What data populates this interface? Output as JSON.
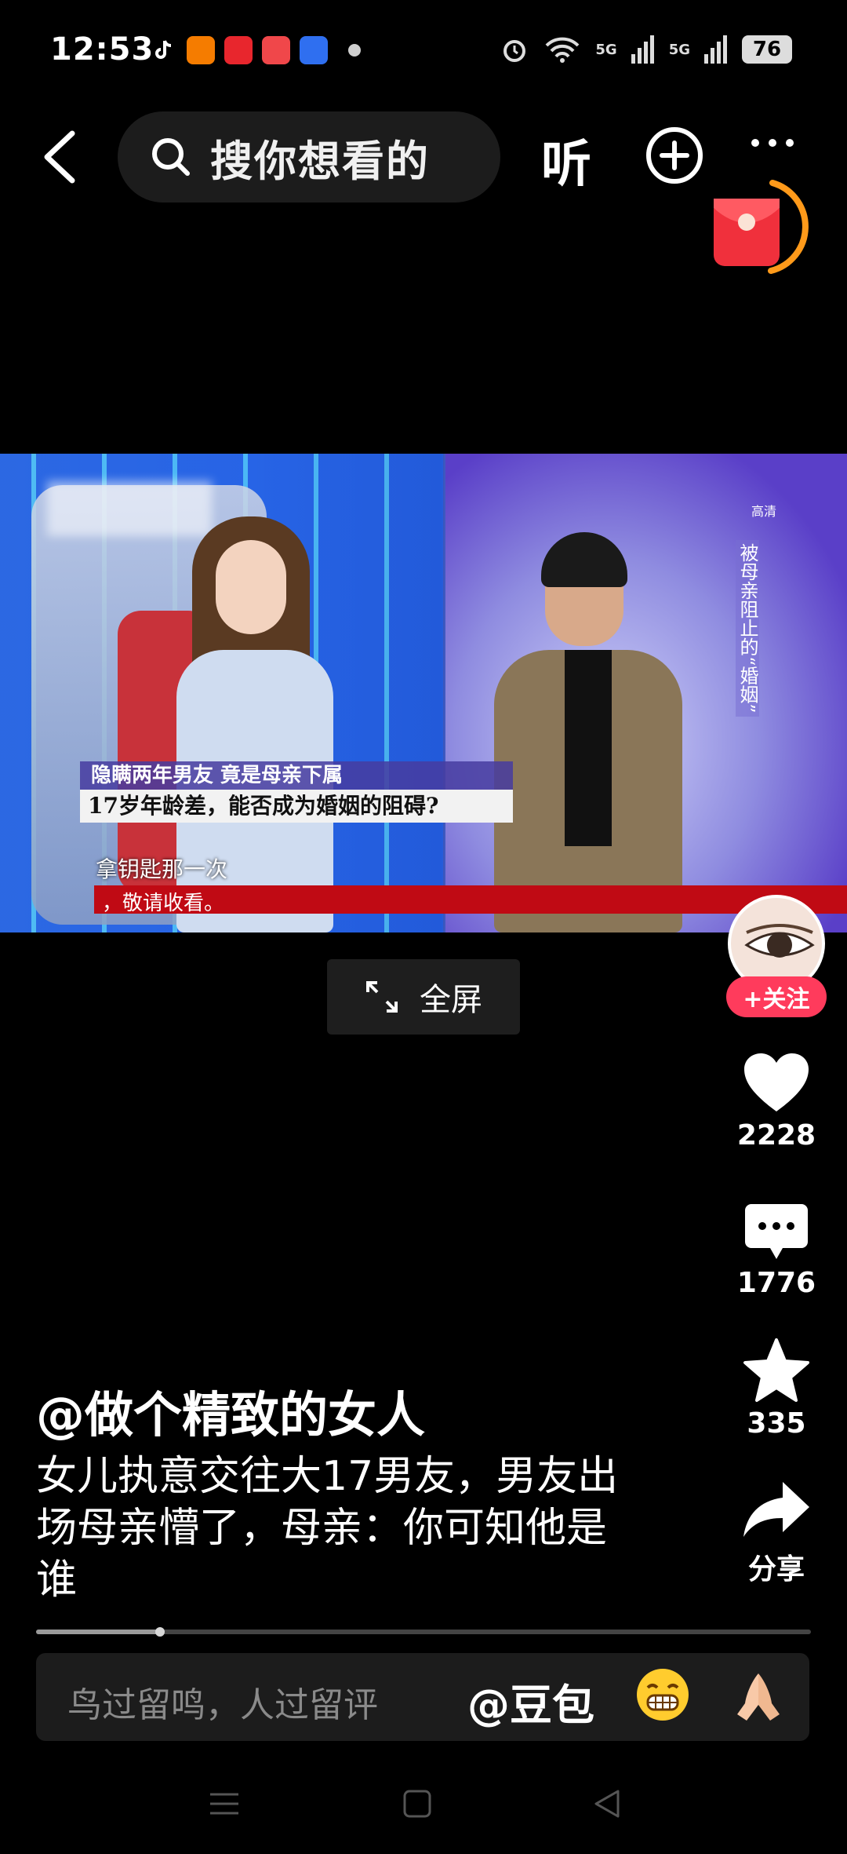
{
  "status_bar": {
    "time": "12:53",
    "signal_1": "5G",
    "signal_2": "5G",
    "battery": "76"
  },
  "top_nav": {
    "search_placeholder": "搜你想看的",
    "listen_label": "听"
  },
  "video": {
    "caption_line1": "隐瞒两年男友   竟是母亲下属",
    "caption_line2": "17岁年龄差，能否成为婚姻的阻碍?",
    "subtitle_1": "拿钥匙那一次",
    "subtitle_2": "，敬请收看。",
    "hd_mark": "高清",
    "vertical_title": "被母亲阻止的“婚姻”"
  },
  "fullscreen": {
    "label": "全屏"
  },
  "rail": {
    "follow_label": "+关注",
    "likes": "2228",
    "comments": "1776",
    "favorites": "335",
    "share_label": "分享"
  },
  "post": {
    "author": "@做个精致的女人",
    "description": "女儿执意交往大17男友，男友出场母亲懵了，母亲：你可知他是谁"
  },
  "playback": {
    "progress": 0.16
  },
  "comment_bar": {
    "placeholder": "鸟过留鸣，人过留评",
    "mention": "@豆包"
  },
  "colors": {
    "accent": "#ff3b5c",
    "background": "#000000",
    "redpacket_ring": "#ff9a1a"
  },
  "icons": [
    "back-icon",
    "search-icon",
    "add-icon",
    "more-icon",
    "redpacket-icon",
    "expand-icon",
    "heart-icon",
    "comment-icon",
    "star-icon",
    "share-icon",
    "grin-emoji-icon",
    "pray-emoji-icon",
    "menu-icon",
    "home-icon",
    "back-nav-icon"
  ]
}
